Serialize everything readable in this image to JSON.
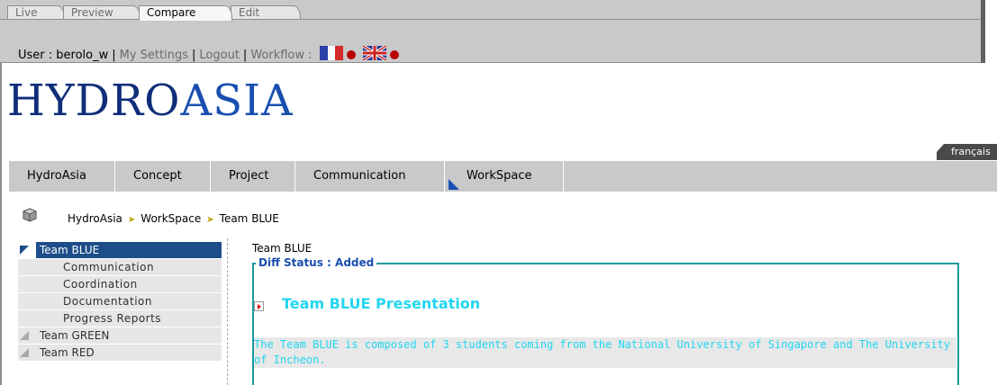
{
  "mode_tabs": [
    {
      "label": "Live",
      "active": false
    },
    {
      "label": "Preview",
      "active": false
    },
    {
      "label": "Compare",
      "active": true
    },
    {
      "label": "Edit",
      "active": false
    }
  ],
  "userbar": {
    "user_label": "User : berolo_w",
    "sep": "|",
    "my_settings": "My Settings",
    "logout": "Logout",
    "workflow": "Workflow :",
    "flags": [
      "french-flag-icon",
      "uk-flag-icon"
    ]
  },
  "logo": {
    "part_a": "HYDRO",
    "part_b": "ASIA"
  },
  "lang_switch": "français",
  "main_nav": [
    {
      "label": "HydroAsia",
      "active": false
    },
    {
      "label": "Concept",
      "active": false
    },
    {
      "label": "Project",
      "active": false
    },
    {
      "label": "Communication",
      "active": false
    },
    {
      "label": "WorkSpace",
      "active": true
    }
  ],
  "breadcrumb": {
    "items": [
      "HydroAsia",
      "WorkSpace",
      "Team BLUE"
    ],
    "arrow": "➤"
  },
  "sidebar": {
    "items": [
      {
        "label": "Team BLUE",
        "kind": "top"
      },
      {
        "label": "Communication",
        "kind": "sub"
      },
      {
        "label": "Coordination",
        "kind": "sub"
      },
      {
        "label": "Documentation",
        "kind": "sub"
      },
      {
        "label": "Progress Reports",
        "kind": "sub"
      },
      {
        "label": "Team GREEN",
        "kind": "grp"
      },
      {
        "label": "Team RED",
        "kind": "grp"
      }
    ]
  },
  "content": {
    "title": "Team BLUE",
    "diff_status": "Diff Status : Added",
    "presentation": "Team BLUE Presentation",
    "description": "The Team BLUE is composed of 3 students coming from the National University of Singapore and The University of Incheon."
  },
  "colors": {
    "accent": "#1e4e8a",
    "diff_border": "#1a9aa0",
    "added_text": "#20d6f0",
    "flag_dot": "#b80000"
  }
}
